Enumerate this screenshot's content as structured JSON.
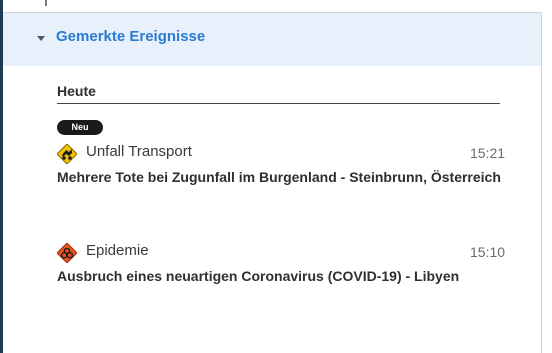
{
  "panel": {
    "title": "Gemerkte Ereignisse"
  },
  "section": {
    "title": "Heute"
  },
  "events": [
    {
      "badge": "Neu",
      "icon": "accident-transport-icon",
      "category": "Unfall Transport",
      "time": "15:21",
      "title": "Mehrere Tote bei Zugunfall im Burgenland - Steinbrunn, Österreich"
    },
    {
      "icon": "biohazard-icon",
      "category": "Epidemie",
      "time": "15:10",
      "title": "Ausbruch eines neuartigen Coronavirus (COVID-19) - Libyen"
    }
  ],
  "colors": {
    "header_bg": "#e8f1fb",
    "header_text": "#2b7bd0",
    "badge_bg": "#1b1b1b",
    "warning_yellow": "#f2c200",
    "epidemic_orange": "#e8541e"
  }
}
